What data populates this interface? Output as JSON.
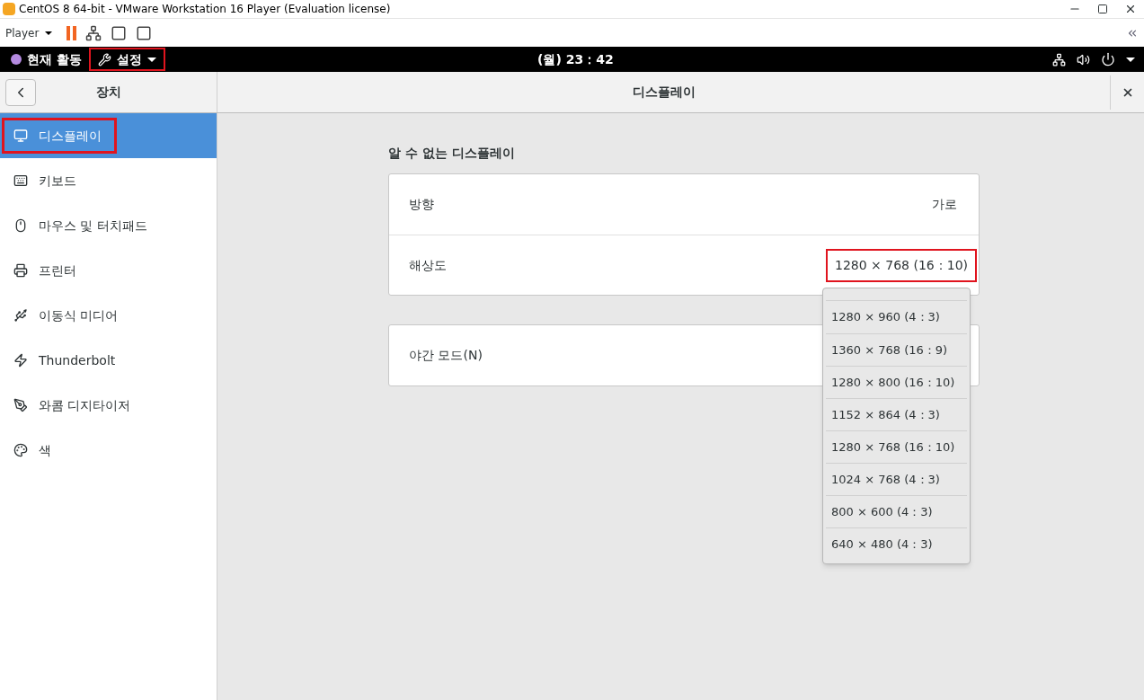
{
  "window": {
    "title": "CentOS 8 64-bit - VMware Workstation 16 Player (Evaluation license)"
  },
  "toolbar": {
    "player_menu": "Player"
  },
  "top_bar": {
    "activities": "현재 활동",
    "app_menu": {
      "label": "설정",
      "highlighted": true
    },
    "clock": "(월) 23：42"
  },
  "header": {
    "sidebar_title": "장치",
    "title": "디스플레이"
  },
  "sidebar": {
    "items": [
      {
        "label": "디스플레이",
        "selected": true,
        "highlighted": true
      },
      {
        "label": "키보드",
        "selected": false,
        "highlighted": false
      },
      {
        "label": "마우스 및 터치패드",
        "selected": false,
        "highlighted": false
      },
      {
        "label": "프린터",
        "selected": false,
        "highlighted": false
      },
      {
        "label": "이동식 미디어",
        "selected": false,
        "highlighted": false
      },
      {
        "label": "Thunderbolt",
        "selected": false,
        "highlighted": false
      },
      {
        "label": "와콤 디지타이저",
        "selected": false,
        "highlighted": false
      },
      {
        "label": "색",
        "selected": false,
        "highlighted": false
      }
    ]
  },
  "display": {
    "group_title": "알 수 없는 디스플레이",
    "rows": [
      {
        "label": "방향",
        "value": "가로",
        "highlighted": false
      },
      {
        "label": "해상도",
        "value": "1280 × 768 (16：10)",
        "highlighted": true
      }
    ],
    "night_light": {
      "label": "야간 모드(N)"
    }
  },
  "resolution_popover": {
    "options": [
      {
        "label": "1280 × 960 (4：3)"
      },
      {
        "label": "1360 × 768 (16：9)"
      },
      {
        "label": "1280 × 800 (16：10)"
      },
      {
        "label": "1152 × 864 (4：3)"
      },
      {
        "label": "1280 × 768 (16：10)"
      },
      {
        "label": "1024 × 768 (4：3)"
      },
      {
        "label": "800 × 600 (4：3)"
      },
      {
        "label": "640 × 480 (4：3)"
      }
    ]
  }
}
